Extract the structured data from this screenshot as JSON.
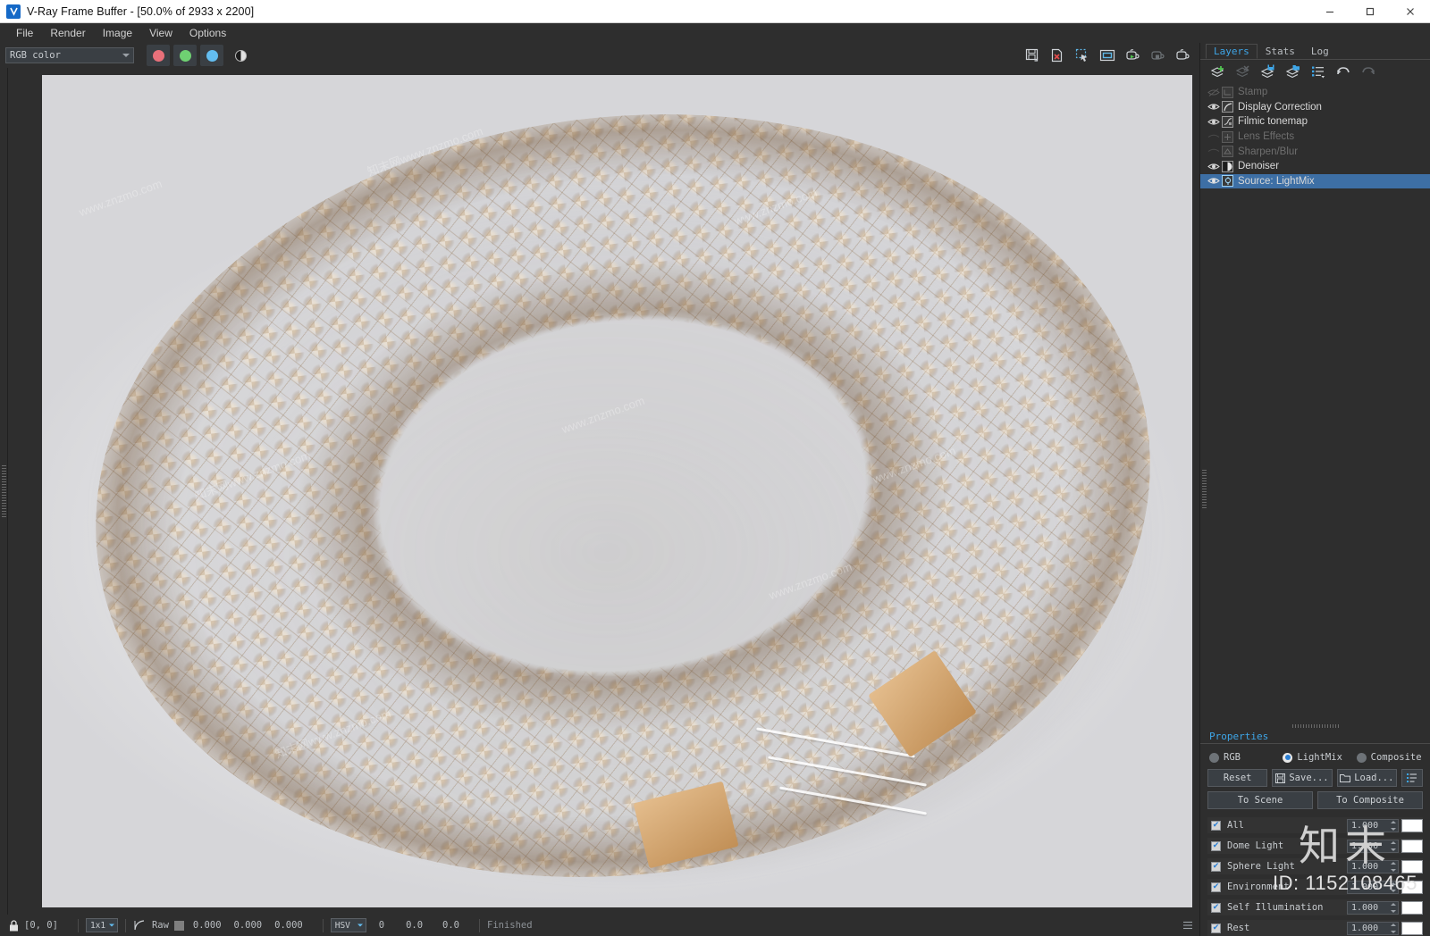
{
  "window": {
    "title": "V-Ray Frame Buffer - [50.0% of 2933 x 2200]",
    "icon": "vray-logo-icon",
    "minimize": "–",
    "maximize": "☐",
    "close": "✕"
  },
  "menu": {
    "items": [
      "File",
      "Render",
      "Image",
      "View",
      "Options"
    ]
  },
  "toolbar": {
    "channel_select": "RGB color",
    "red_channel": "red-channel",
    "green_channel": "green-channel",
    "blue_channel": "blue-channel",
    "mono_channel": "monochrome-channel",
    "right_icons": [
      "save-image-icon",
      "clear-image-icon",
      "region-render-icon",
      "viewport-icon",
      "render-last-icon",
      "render-stop-icon",
      "render-icon"
    ]
  },
  "render": {
    "watermarks": [
      "www.znzmo.com",
      "知末网www.znzmo.com",
      "www.znzmo.com",
      "知末网www.znzmo.com",
      "www.znzmo.com",
      "www.znzmo.com",
      "知末网www.znzmo.com",
      "www.znzmo.com"
    ],
    "colors": {
      "leather_light": "#e7c396",
      "leather_mid": "#d2a270",
      "leather_dark": "#b9884f",
      "backdrop": "#e9e9ea"
    }
  },
  "statusbar": {
    "lock_icon": "lock-icon",
    "coords": "[0, 0]",
    "pixel_aspect": "1x1",
    "curve_icon": "curve-icon",
    "raw_label": "Raw",
    "raw_swatch": "#7f7f7f",
    "raw_values": [
      "0.000",
      "0.000",
      "0.000"
    ],
    "color_mode": "HSV",
    "hsv_values": [
      "0",
      "0.0",
      "0.0"
    ],
    "status": "Finished",
    "history_icon": "history-icon"
  },
  "right_panel": {
    "tabs": [
      {
        "label": "Layers",
        "active": true
      },
      {
        "label": "Stats",
        "active": false
      },
      {
        "label": "Log",
        "active": false
      }
    ],
    "layer_toolbar": [
      {
        "name": "add-layer-icon",
        "enabled": true
      },
      {
        "name": "delete-layer-icon",
        "enabled": false
      },
      {
        "name": "save-layers-icon",
        "enabled": true
      },
      {
        "name": "load-layers-icon",
        "enabled": true
      },
      {
        "name": "layer-presets-icon",
        "enabled": true
      },
      {
        "name": "undo-icon",
        "enabled": true
      },
      {
        "name": "redo-icon",
        "enabled": false
      }
    ],
    "layers": [
      {
        "label": "Stamp",
        "visible": false,
        "enabled": false,
        "selected": false,
        "thumb": "stamp-icon"
      },
      {
        "label": "Display Correction",
        "visible": true,
        "enabled": true,
        "selected": false,
        "thumb": "curve-icon"
      },
      {
        "label": "Filmic tonemap",
        "visible": true,
        "enabled": true,
        "selected": false,
        "thumb": "filmic-icon"
      },
      {
        "label": "Lens Effects",
        "visible": false,
        "enabled": false,
        "selected": false,
        "thumb": "lens-icon"
      },
      {
        "label": "Sharpen/Blur",
        "visible": false,
        "enabled": false,
        "selected": false,
        "thumb": "sharpen-icon"
      },
      {
        "label": "Denoiser",
        "visible": true,
        "enabled": true,
        "selected": false,
        "thumb": "denoiser-icon"
      },
      {
        "label": "Source: LightMix",
        "visible": true,
        "enabled": true,
        "selected": true,
        "thumb": "lightmix-icon"
      }
    ],
    "properties": {
      "title": "Properties",
      "modes": [
        {
          "label": "RGB",
          "selected": false
        },
        {
          "label": "LightMix",
          "selected": true
        },
        {
          "label": "Composite",
          "selected": false
        }
      ],
      "buttons": {
        "reset": "Reset",
        "save": "Save...",
        "load": "Load...",
        "menu_icon": "list-menu-icon",
        "to_scene": "To Scene",
        "to_composite": "To Composite"
      },
      "lightmix_rows": [
        {
          "label": "All",
          "checked": true,
          "value": "1.000",
          "color": "#ffffff"
        },
        {
          "label": "Dome Light",
          "checked": true,
          "value": "1.000",
          "color": "#ffffff"
        },
        {
          "label": "Sphere Light",
          "checked": true,
          "value": "1.000",
          "color": "#ffffff"
        },
        {
          "label": "Environment",
          "checked": true,
          "value": "1.000",
          "color": "#ffffff"
        },
        {
          "label": "Self Illumination",
          "checked": true,
          "value": "1.000",
          "color": "#ffffff"
        },
        {
          "label": "Rest",
          "checked": true,
          "value": "1.000",
          "color": "#ffffff"
        }
      ]
    }
  },
  "watermark": {
    "logo": "知末",
    "id": "ID: 1152108465"
  }
}
